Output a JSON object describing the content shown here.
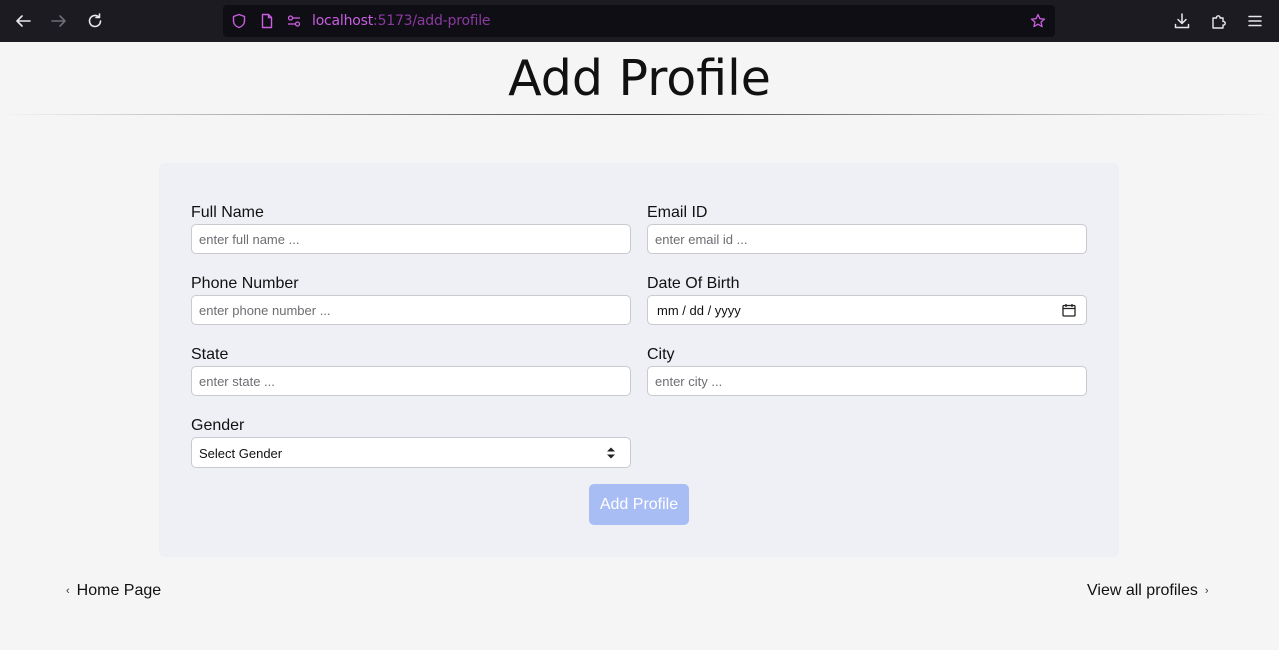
{
  "browser": {
    "url_host": "localhost",
    "url_path": ":5173/add-profile"
  },
  "page": {
    "title": "Add Profile"
  },
  "form": {
    "full_name": {
      "label": "Full Name",
      "placeholder": "enter full name ..."
    },
    "email": {
      "label": "Email ID",
      "placeholder": "enter email id ..."
    },
    "phone": {
      "label": "Phone Number",
      "placeholder": "enter phone number ..."
    },
    "dob": {
      "label": "Date Of Birth",
      "value": "mm / dd / yyyy"
    },
    "state": {
      "label": "State",
      "placeholder": "enter state ..."
    },
    "city": {
      "label": "City",
      "placeholder": "enter city ..."
    },
    "gender": {
      "label": "Gender",
      "selected": "Select Gender"
    },
    "submit_label": "Add Profile"
  },
  "nav": {
    "home_label": "Home Page",
    "view_all_label": "View all profiles"
  },
  "colors": {
    "submit_button": "#a8bdf4",
    "card_background": "#eef0f6",
    "browser_toolbar": "#1c1b22",
    "url_accent": "#c95ee0"
  }
}
